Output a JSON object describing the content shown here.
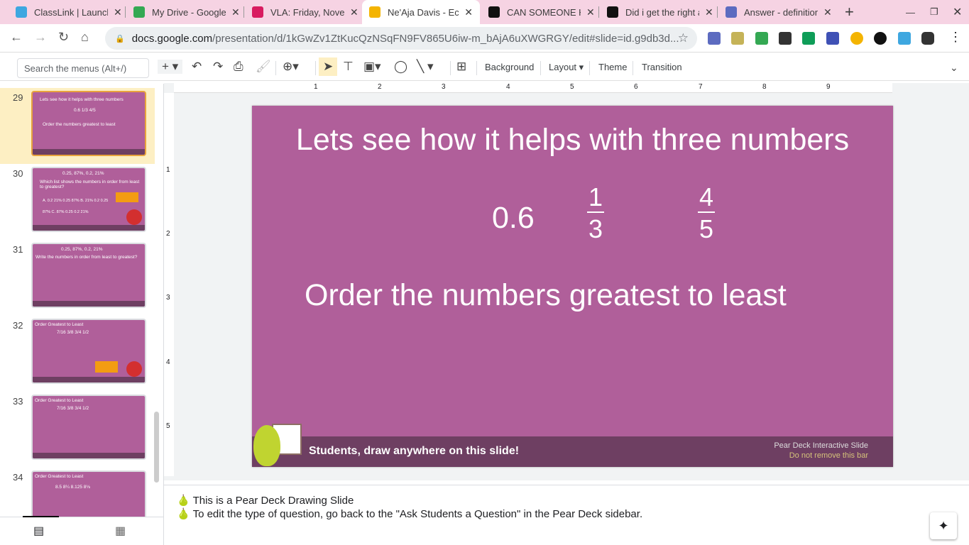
{
  "browser": {
    "tabs": [
      {
        "title": "ClassLink | Launchpad",
        "color": "#3ea7e0"
      },
      {
        "title": "My Drive - Google Drive",
        "color": "#34a853"
      },
      {
        "title": "VLA: Friday, November",
        "color": "#d81b60"
      },
      {
        "title": "Ne'Aja Davis - Echo",
        "color": "#f4b400",
        "active": true
      },
      {
        "title": "CAN SOMEONE HELP",
        "color": "#111111"
      },
      {
        "title": "Did i get the right answer",
        "color": "#111111"
      },
      {
        "title": "Answer - definition",
        "color": "#5c6bc0"
      }
    ],
    "url_host": "docs.google.com",
    "url_path": "/presentation/d/1kGwZv1ZtKucQzNSqFN9FV865U6iw-m_bAjA6uXWGRGY/edit#slide=id.g9db3d..."
  },
  "toolbar": {
    "search_placeholder": "Search the menus (Alt+/)",
    "background": "Background",
    "layout": "Layout",
    "theme": "Theme",
    "transition": "Transition"
  },
  "filmstrip": [
    {
      "num": "29",
      "title": "Lets see how it helps with three numbers",
      "line2": "0.6   1/3   4/5",
      "line3": "Order the numbers greatest to least",
      "selected": true
    },
    {
      "num": "30",
      "title": "0.25,  87%,  0.2,  21%",
      "line2": "Which list shows the numbers in order from least to greatest?",
      "line3": "A. 0.2  21%  0.25  87%   B. 21%  0.2  0.25  87%   C. 87%  0.25  0.2  21%"
    },
    {
      "num": "31",
      "title": "0.25,  87%,  0.2,  21%",
      "line2": "Write the numbers in order from least to greatest?",
      "line3": ""
    },
    {
      "num": "32",
      "title": "Order Greatest to Least",
      "line2": "7/16   3/8   3/4   1/2",
      "line3": ""
    },
    {
      "num": "33",
      "title": "Order Greatest to Least",
      "line2": "7/16   3/8   3/4   1/2",
      "line3": ""
    },
    {
      "num": "34",
      "title": "Order Greatest to Least",
      "line2": "8.5   8¼   8.125   8⅛",
      "line3": ""
    }
  ],
  "slide": {
    "title": "Lets see how it helps with three numbers",
    "decimal": "0.6",
    "frac1": {
      "n": "1",
      "d": "3"
    },
    "frac2": {
      "n": "4",
      "d": "5"
    },
    "prompt": "Order the numbers greatest to least",
    "bar_text": "Students, draw anywhere on this slide!",
    "bar_right1": "Pear Deck Interactive Slide",
    "bar_right2": "Do not remove this bar"
  },
  "ruler": [
    "1",
    "2",
    "3",
    "4",
    "5",
    "6",
    "7",
    "8",
    "9"
  ],
  "ruler_left": [
    "1",
    "2",
    "3",
    "4",
    "5"
  ],
  "notes": [
    "This is a Pear Deck Drawing Slide",
    "To edit the type of question, go back to the \"Ask Students a Question\" in the Pear Deck sidebar."
  ]
}
